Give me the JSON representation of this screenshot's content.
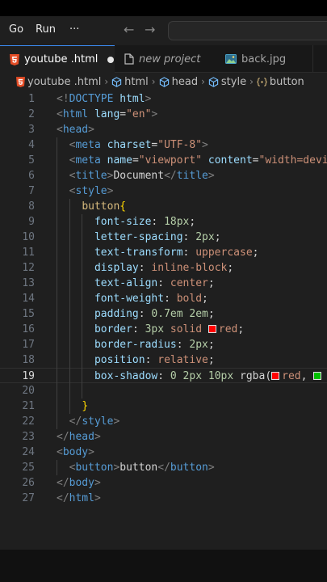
{
  "menu": {
    "go": "Go",
    "run": "Run",
    "more": "···"
  },
  "tabs": [
    {
      "label": "youtube .html",
      "icon": "html5-icon",
      "active": true,
      "modified": true
    },
    {
      "label": "new project",
      "icon": "file-icon",
      "active": false
    },
    {
      "label": "back.jpg",
      "icon": "image-icon",
      "active": false
    }
  ],
  "breadcrumb": [
    "youtube .html",
    "html",
    "head",
    "style",
    "button"
  ],
  "editor": {
    "current_line": 19,
    "lines": [
      [
        [
          "br",
          "<!"
        ],
        [
          "tag",
          "DOCTYPE"
        ],
        [
          "plain",
          " "
        ],
        [
          "attr",
          "html"
        ],
        [
          "br",
          ">"
        ]
      ],
      [
        [
          "br",
          "<"
        ],
        [
          "tag",
          "html"
        ],
        [
          "plain",
          " "
        ],
        [
          "attr",
          "lang"
        ],
        [
          "plain",
          "="
        ],
        [
          "str",
          "\"en\""
        ],
        [
          "br",
          ">"
        ]
      ],
      [
        [
          "br",
          "<"
        ],
        [
          "tag",
          "head"
        ],
        [
          "br",
          ">"
        ]
      ],
      [
        [
          "plain",
          "  "
        ],
        [
          "br",
          "<"
        ],
        [
          "tag",
          "meta"
        ],
        [
          "plain",
          " "
        ],
        [
          "attr",
          "charset"
        ],
        [
          "plain",
          "="
        ],
        [
          "str",
          "\"UTF-8\""
        ],
        [
          "br",
          ">"
        ]
      ],
      [
        [
          "plain",
          "  "
        ],
        [
          "br",
          "<"
        ],
        [
          "tag",
          "meta"
        ],
        [
          "plain",
          " "
        ],
        [
          "attr",
          "name"
        ],
        [
          "plain",
          "="
        ],
        [
          "str",
          "\"viewport\""
        ],
        [
          "plain",
          " "
        ],
        [
          "attr",
          "content"
        ],
        [
          "plain",
          "="
        ],
        [
          "str",
          "\"width=device-width\""
        ]
      ],
      [
        [
          "plain",
          "  "
        ],
        [
          "br",
          "<"
        ],
        [
          "tag",
          "title"
        ],
        [
          "br",
          ">"
        ],
        [
          "plain",
          "Document"
        ],
        [
          "br",
          "</"
        ],
        [
          "tag",
          "title"
        ],
        [
          "br",
          ">"
        ]
      ],
      [
        [
          "plain",
          "  "
        ],
        [
          "br",
          "<"
        ],
        [
          "tag",
          "style"
        ],
        [
          "br",
          ">"
        ]
      ],
      [
        [
          "plain",
          "    "
        ],
        [
          "sel",
          "button"
        ],
        [
          "brace",
          "{"
        ]
      ],
      [
        [
          "plain",
          "      "
        ],
        [
          "prop",
          "font-size"
        ],
        [
          "plain",
          ": "
        ],
        [
          "num",
          "18px"
        ],
        [
          "plain",
          ";"
        ]
      ],
      [
        [
          "plain",
          "      "
        ],
        [
          "prop",
          "letter-spacing"
        ],
        [
          "plain",
          ": "
        ],
        [
          "num",
          "2px"
        ],
        [
          "plain",
          ";"
        ]
      ],
      [
        [
          "plain",
          "      "
        ],
        [
          "prop",
          "text-transform"
        ],
        [
          "plain",
          ": "
        ],
        [
          "val",
          "uppercase"
        ],
        [
          "plain",
          ";"
        ]
      ],
      [
        [
          "plain",
          "      "
        ],
        [
          "prop",
          "display"
        ],
        [
          "plain",
          ": "
        ],
        [
          "val",
          "inline-block"
        ],
        [
          "plain",
          ";"
        ]
      ],
      [
        [
          "plain",
          "      "
        ],
        [
          "prop",
          "text-align"
        ],
        [
          "plain",
          ": "
        ],
        [
          "val",
          "center"
        ],
        [
          "plain",
          ";"
        ]
      ],
      [
        [
          "plain",
          "      "
        ],
        [
          "prop",
          "font-weight"
        ],
        [
          "plain",
          ": "
        ],
        [
          "val",
          "bold"
        ],
        [
          "plain",
          ";"
        ]
      ],
      [
        [
          "plain",
          "      "
        ],
        [
          "prop",
          "padding"
        ],
        [
          "plain",
          ": "
        ],
        [
          "num",
          "0.7em 2em"
        ],
        [
          "plain",
          ";"
        ]
      ],
      [
        [
          "plain",
          "      "
        ],
        [
          "prop",
          "border"
        ],
        [
          "plain",
          ": "
        ],
        [
          "num",
          "3px"
        ],
        [
          "plain",
          " "
        ],
        [
          "val",
          "solid"
        ],
        [
          "plain",
          " "
        ],
        [
          "swatch",
          "#ff0000"
        ],
        [
          "val",
          "red"
        ],
        [
          "plain",
          ";"
        ]
      ],
      [
        [
          "plain",
          "      "
        ],
        [
          "prop",
          "border-radius"
        ],
        [
          "plain",
          ": "
        ],
        [
          "num",
          "2px"
        ],
        [
          "plain",
          ";"
        ]
      ],
      [
        [
          "plain",
          "      "
        ],
        [
          "prop",
          "position"
        ],
        [
          "plain",
          ": "
        ],
        [
          "val",
          "relative"
        ],
        [
          "plain",
          ";"
        ]
      ],
      [
        [
          "plain",
          "      "
        ],
        [
          "prop",
          "box-shadow"
        ],
        [
          "plain",
          ": "
        ],
        [
          "num",
          "0 2px 10px"
        ],
        [
          "plain",
          " rgba("
        ],
        [
          "swatch",
          "#ff0000"
        ],
        [
          "val",
          "red"
        ],
        [
          "plain",
          ", "
        ],
        [
          "swatch",
          "#00c000"
        ]
      ],
      [],
      [
        [
          "plain",
          "    "
        ],
        [
          "brace",
          "}"
        ]
      ],
      [
        [
          "plain",
          "  "
        ],
        [
          "br",
          "</"
        ],
        [
          "tag",
          "style"
        ],
        [
          "br",
          ">"
        ]
      ],
      [
        [
          "br",
          "</"
        ],
        [
          "tag",
          "head"
        ],
        [
          "br",
          ">"
        ]
      ],
      [
        [
          "br",
          "<"
        ],
        [
          "tag",
          "body"
        ],
        [
          "br",
          ">"
        ]
      ],
      [
        [
          "plain",
          "  "
        ],
        [
          "br",
          "<"
        ],
        [
          "tag",
          "button"
        ],
        [
          "br",
          ">"
        ],
        [
          "plain",
          "button"
        ],
        [
          "br",
          "</"
        ],
        [
          "tag",
          "button"
        ],
        [
          "br",
          ">"
        ]
      ],
      [
        [
          "br",
          "</"
        ],
        [
          "tag",
          "body"
        ],
        [
          "br",
          ">"
        ]
      ],
      [
        [
          "br",
          "</"
        ],
        [
          "tag",
          "html"
        ],
        [
          "br",
          ">"
        ]
      ]
    ]
  },
  "colors": {
    "editor_bg": "#1f1f1f",
    "accent": "#3c8df5",
    "html5_orange": "#e44d26"
  }
}
